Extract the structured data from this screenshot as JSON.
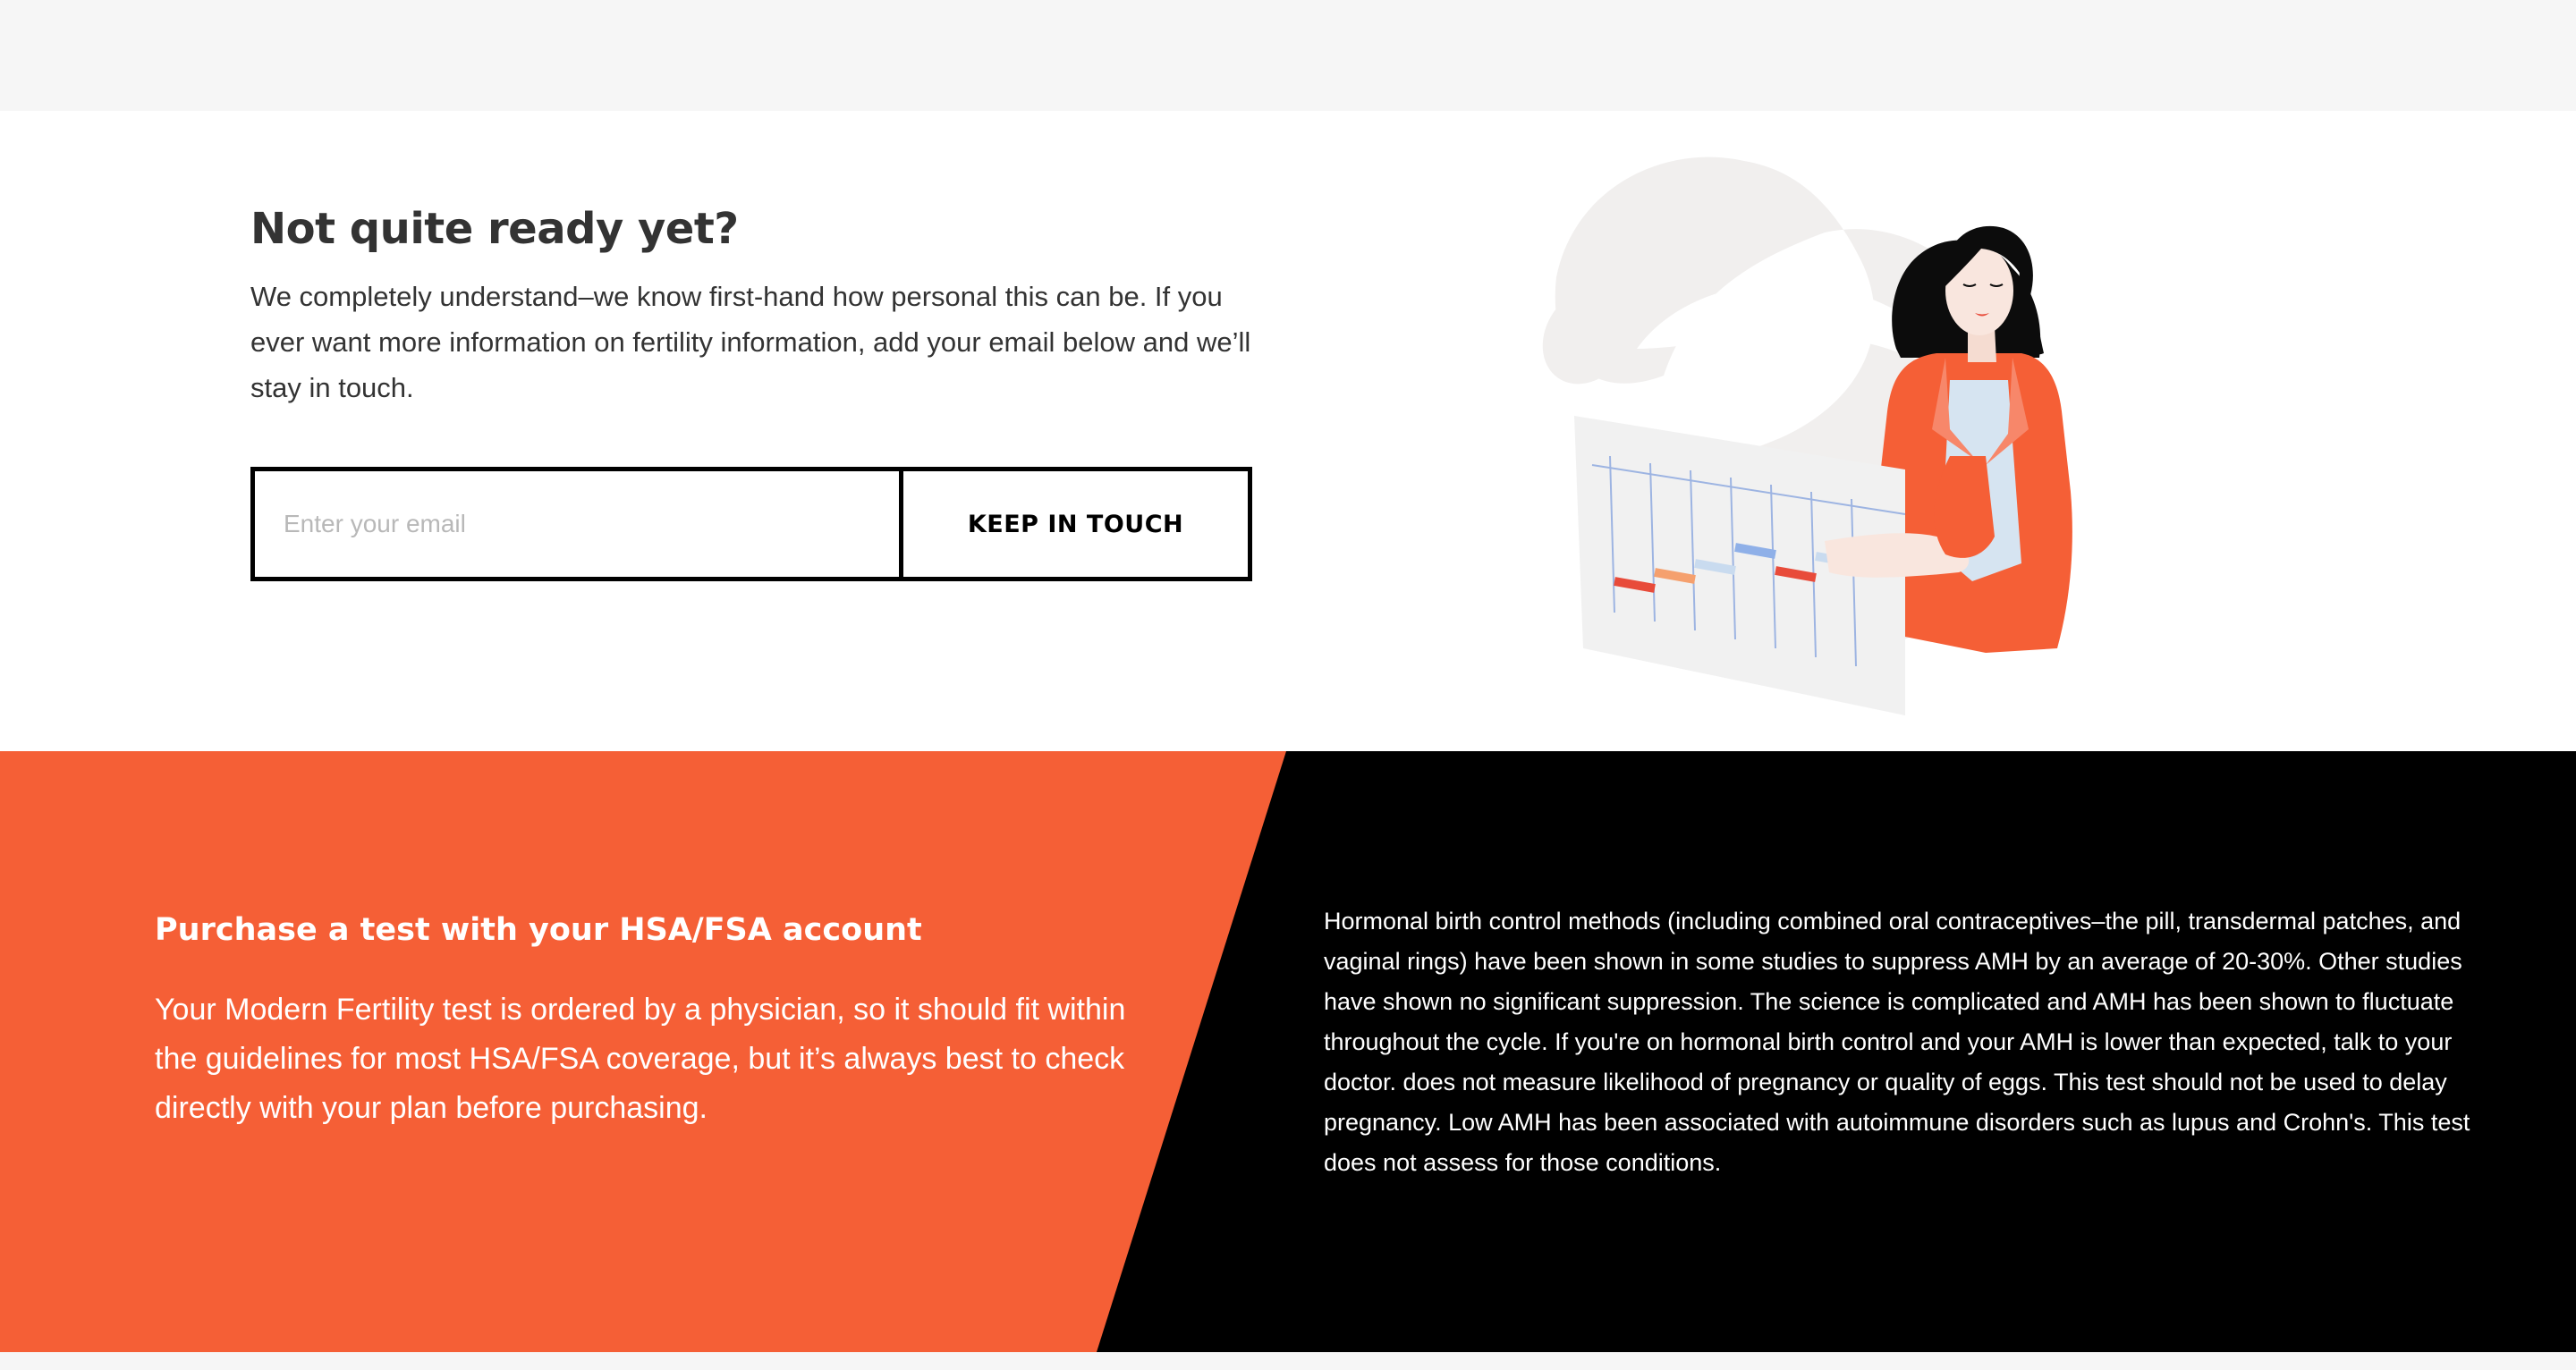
{
  "newsletter": {
    "title": "Not quite ready yet?",
    "body": "We completely understand–we know first-hand how personal this can be. If you ever want more information on fertility information, add your email below and we’ll stay in touch.",
    "email_placeholder": "Enter your email",
    "email_value": "",
    "button_label": "KEEP IN TOUCH"
  },
  "promo": {
    "title": "Purchase a test with your HSA/FSA account",
    "body": "Your Modern Fertility test is ordered by a physician, so it should fit within the guidelines for most HSA/FSA coverage, but it’s always best to check directly with your plan before purchasing.",
    "disclaimer": "Hormonal birth control methods (including combined oral contraceptives–the pill, transdermal patches, and vaginal rings) have been shown in some studies to suppress AMH by an average of 20-30%. Other studies have shown no significant suppression. The science is complicated and AMH has been shown to fluctuate throughout the cycle. If you're on hormonal birth control and your AMH is lower than expected, talk to your doctor. does not measure likelihood of pregnancy or quality of eggs. This test should not be used to delay pregnancy. Low AMH has been associated with autoimmune disorders such as lupus and Crohn's. This test does not assess for those conditions."
  },
  "illustration": {
    "icon": "woman-with-calendar-chart-illustration"
  },
  "colors": {
    "accent": "#f55f36",
    "dark": "#000000",
    "heading": "#333333",
    "page_background": "#f6f6f6",
    "chart_red": "#e84b3a",
    "chart_orange": "#f5a06e",
    "chart_blue": "#8fb0e8",
    "chart_light_blue": "#c9dbef"
  }
}
